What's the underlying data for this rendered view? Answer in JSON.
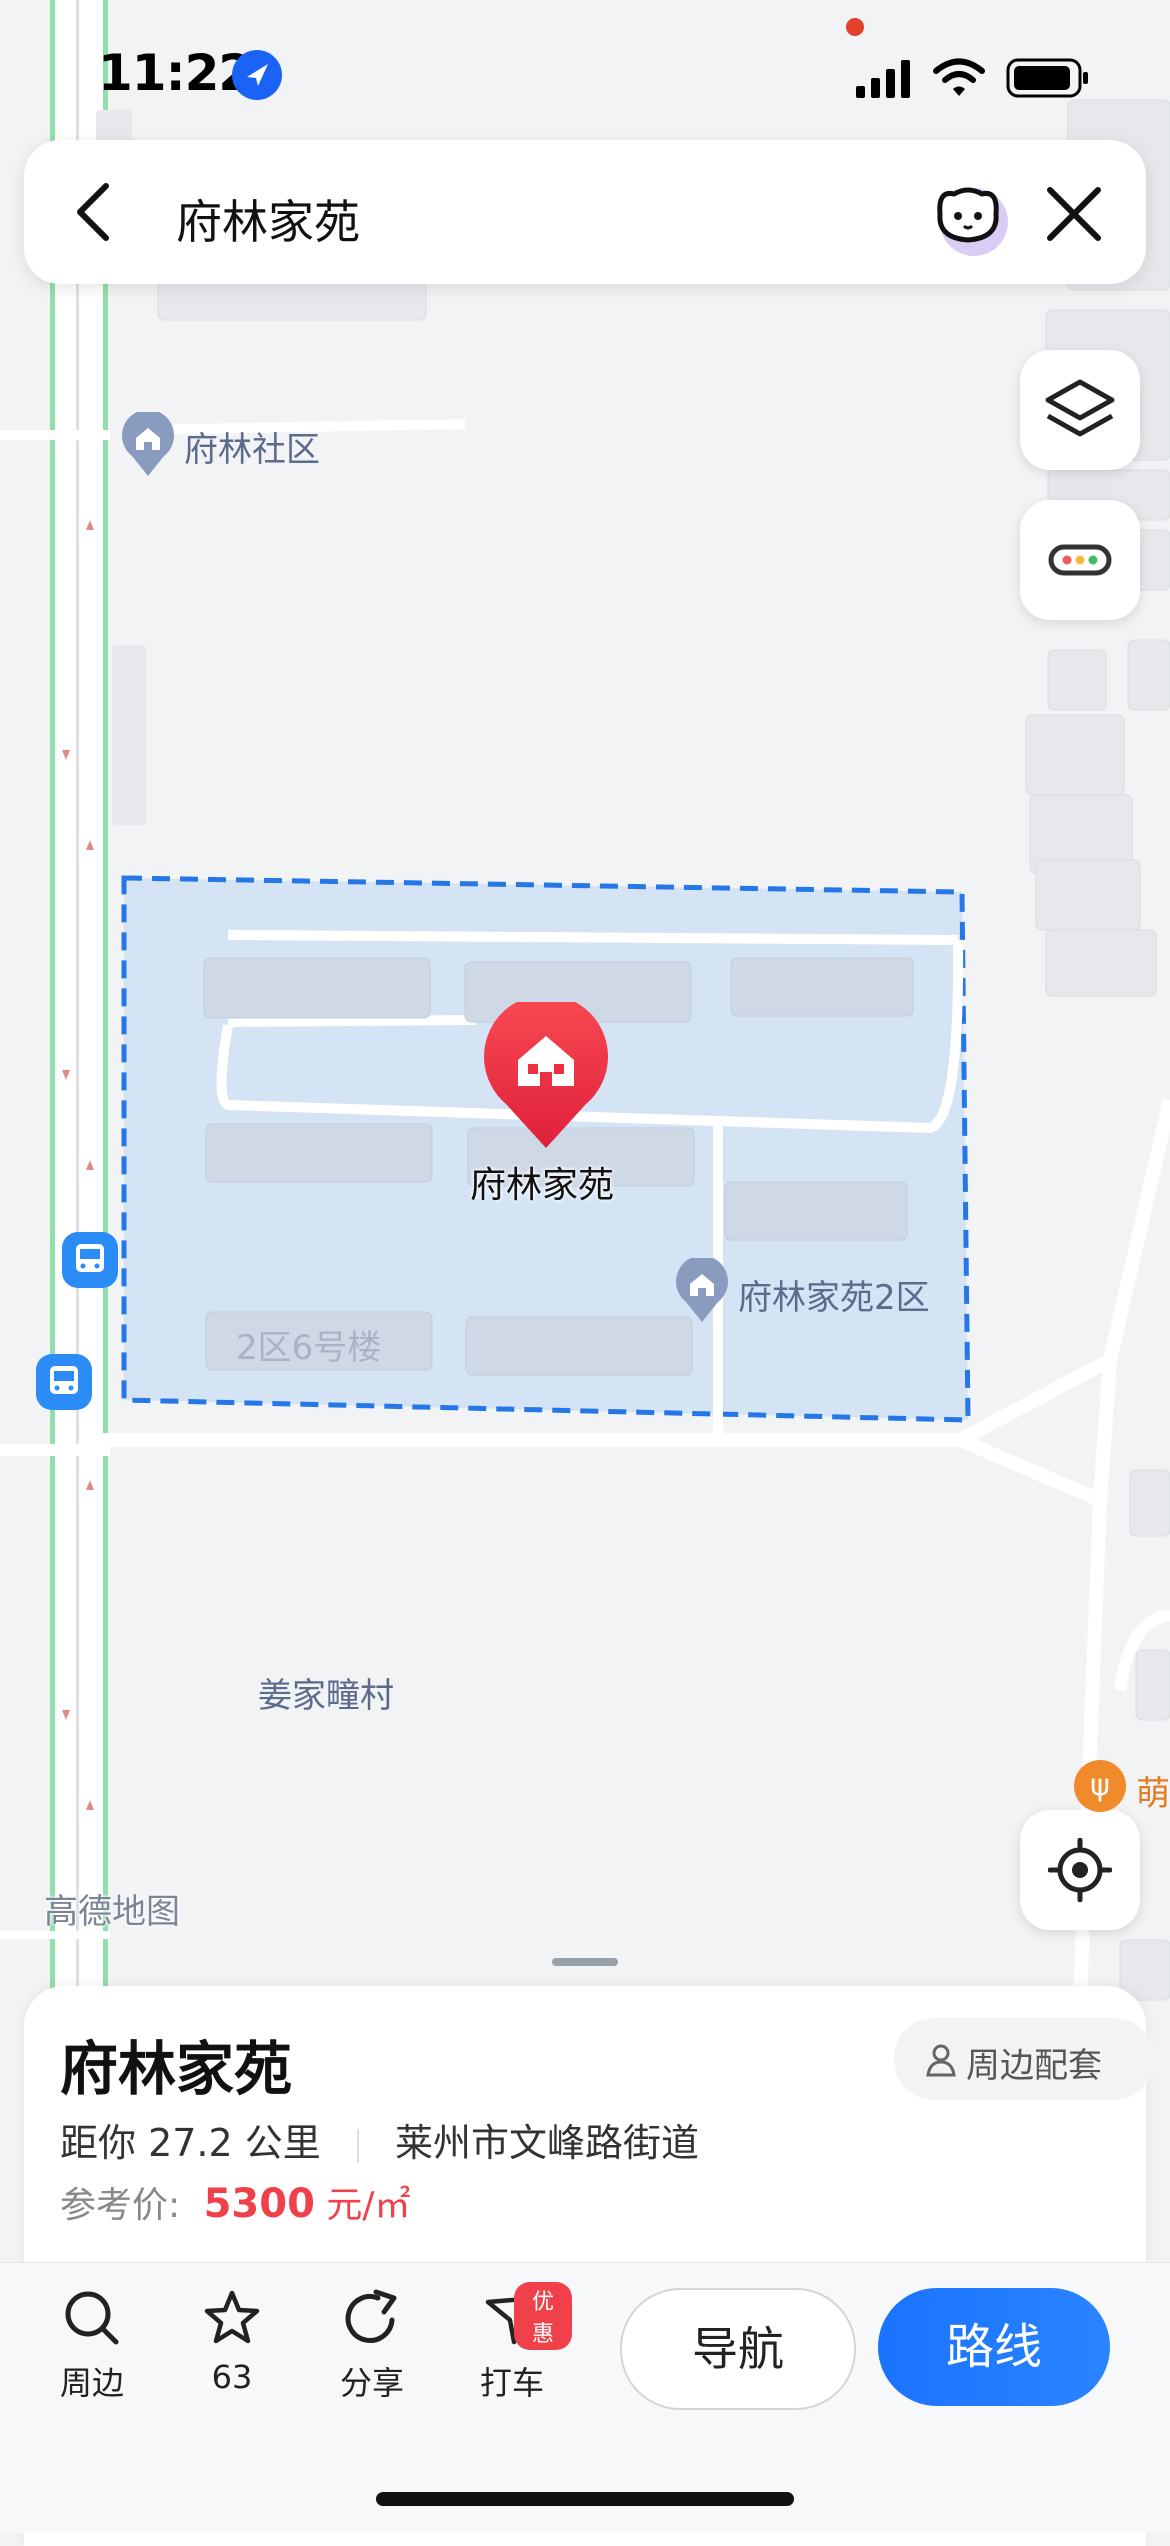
{
  "status": {
    "time": "11:22"
  },
  "search": {
    "query": "府林家苑"
  },
  "map": {
    "labels": {
      "fulin_community": "府林社区",
      "fulin_jiayuan": "府林家苑",
      "fulin_jiayuan_zone2": "府林家苑2区",
      "building_2_6": "2区6号楼",
      "jiangjia_village": "姜家疃村",
      "edge_poi": "萌",
      "watermark": "高德地图"
    }
  },
  "sheet": {
    "title": "府林家苑",
    "nearby_label": "周边配套",
    "distance": "距你 27.2 公里",
    "address": "莱州市文峰路街道",
    "price_label": "参考价:",
    "price_value": "5300",
    "price_unit": "元/㎡"
  },
  "toolbar": {
    "nearby": "周边",
    "favorite_count": "63",
    "share": "分享",
    "taxi": "打车",
    "taxi_badge": "优惠",
    "navigate": "导航",
    "route": "路线"
  },
  "colors": {
    "accent": "#1a73ff",
    "pin": "#ee3344",
    "price": "#f0404a",
    "area_fill": "#d4e4f5",
    "area_border": "#2577e8"
  }
}
